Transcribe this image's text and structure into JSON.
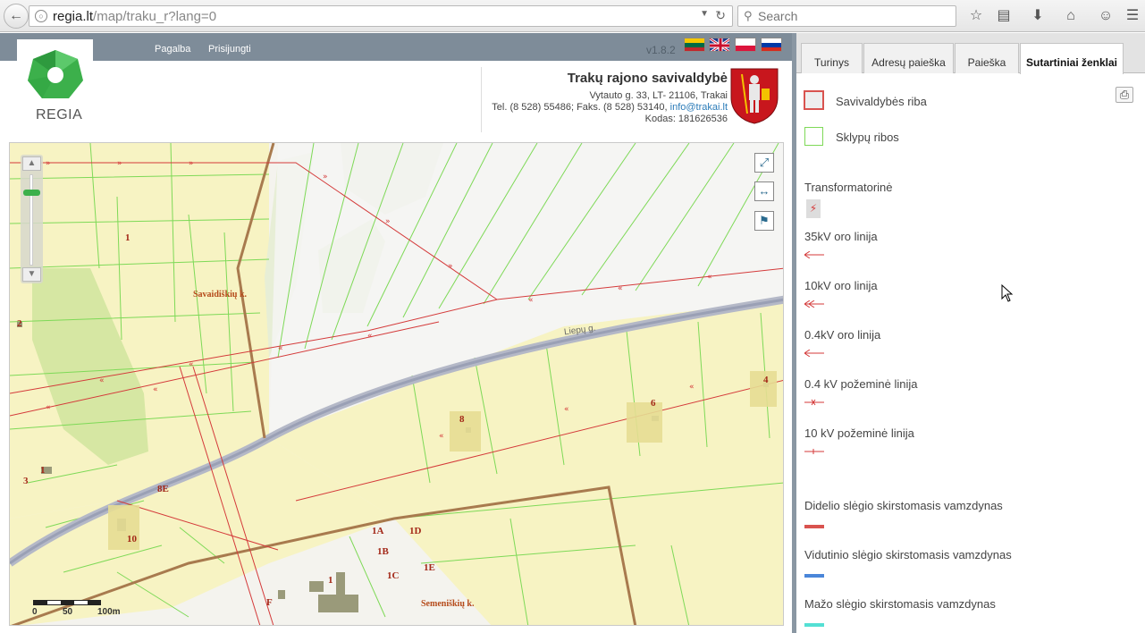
{
  "browser": {
    "url_domain": "regia.lt",
    "url_path": "/map/traku_r?lang=0",
    "search_placeholder": "Search"
  },
  "header": {
    "nav": [
      "Pagalba",
      "Prisijungti"
    ],
    "version": "v1.8.2",
    "logo_text": "REGIA",
    "municipality": {
      "title": "Trakų rajono savivaldybė",
      "address": "Vytauto g. 33, LT- 21106, Trakai",
      "contacts_prefix": "Tel. (8 528) 55486; Faks. (8 528) 53140,",
      "email": "info@trakai.lt",
      "code": "Kodas: 181626536"
    },
    "flags": [
      "lithuanian-flag",
      "uk-flag",
      "polish-flag",
      "russian-flag"
    ]
  },
  "map": {
    "scale_labels": [
      "0",
      "50",
      "100m"
    ],
    "road_label": "Liepų g.",
    "place_labels": [
      "Savaidiškių k.",
      "Semeniškių k."
    ],
    "parcel_labels": [
      "1",
      "2",
      "3",
      "1",
      "8E",
      "10",
      "8",
      "6",
      "4",
      "1A",
      "1D",
      "1B",
      "1C",
      "1E",
      "1",
      "F"
    ]
  },
  "panel": {
    "tabs": [
      "Turinys",
      "Adresų paieška",
      "Paieška",
      "Sutartiniai ženklai"
    ],
    "active_tab": "Sutartiniai ženklai",
    "legend": [
      {
        "label": "Savivaldybės riba",
        "color": "#d9534f"
      },
      {
        "label": "Sklypų ribos",
        "color": "#7ed957"
      },
      {
        "label": "Transformatorinė",
        "color": "#d43a3a"
      },
      {
        "label": "35kV oro linija",
        "color": "#d43a3a"
      },
      {
        "label": "10kV oro linija",
        "color": "#d43a3a"
      },
      {
        "label": "0.4kV oro linija",
        "color": "#d43a3a"
      },
      {
        "label": "0.4 kV požeminė linija",
        "color": "#d43a3a"
      },
      {
        "label": "10 kV požeminė linija",
        "color": "#d43a3a"
      },
      {
        "label": "Didelio slėgio skirstomasis vamzdynas",
        "color": "#d9534f"
      },
      {
        "label": "Vidutinio slėgio skirstomasis vamzdynas",
        "color": "#4a86d9"
      },
      {
        "label": "Mažo slėgio skirstomasis vamzdynas",
        "color": "#54e0d4"
      }
    ]
  },
  "colors": {
    "header_bar": "#7e8c99",
    "parcel_fill": "#f7f3c3",
    "parcel_line": "#7ed957",
    "boundary": "#a87a4e",
    "power_line": "#d43a3a"
  }
}
